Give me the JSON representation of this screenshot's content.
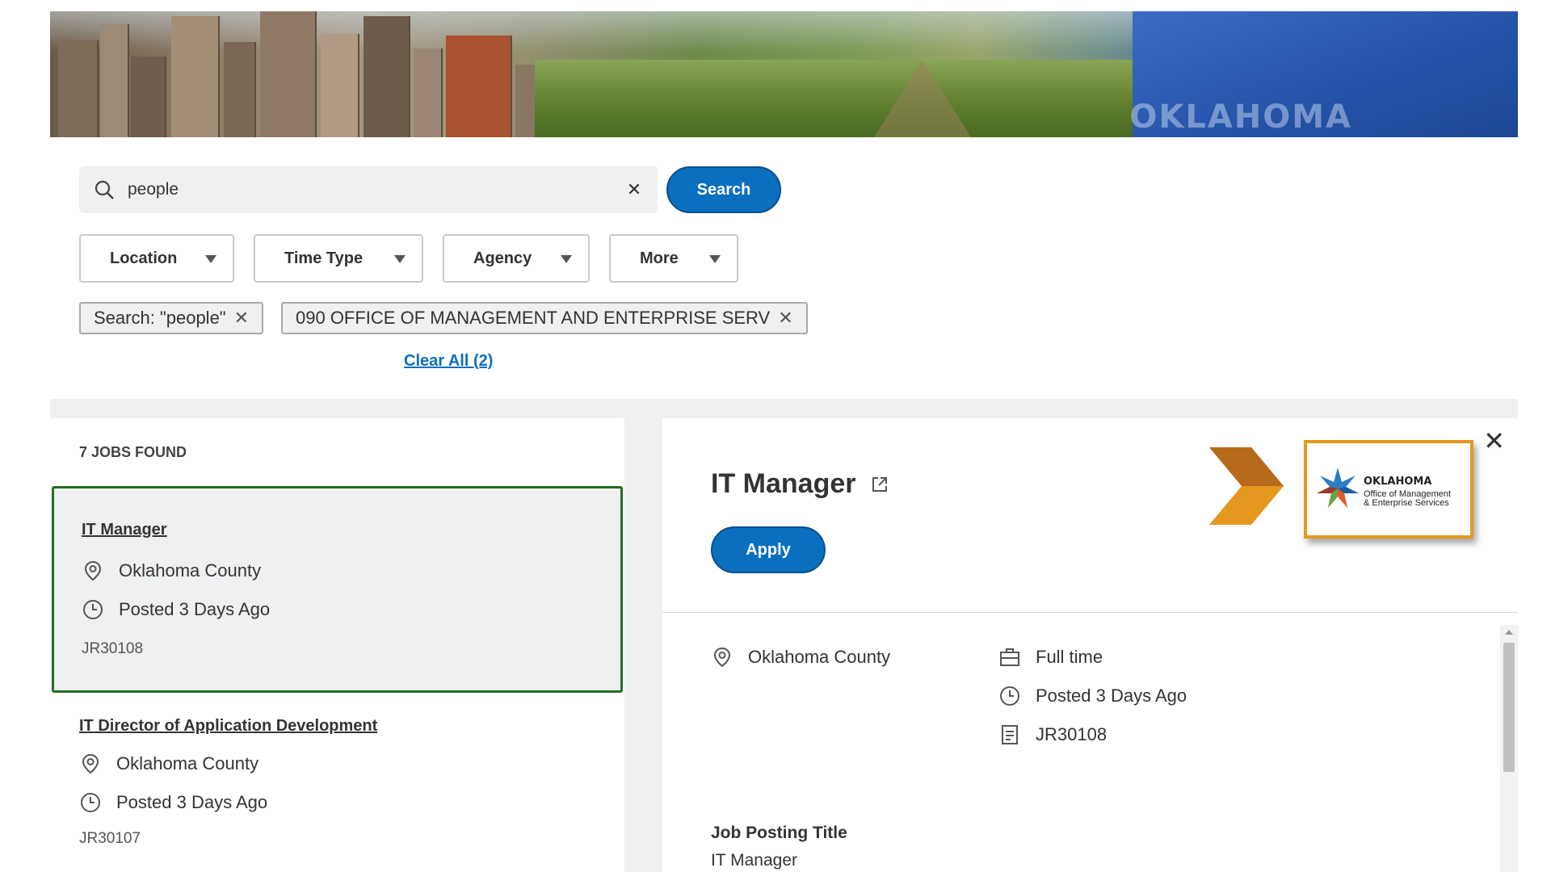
{
  "banner": {
    "flag_word": "OKLAHOMA"
  },
  "search": {
    "value": "people",
    "button_label": "Search"
  },
  "filters": [
    {
      "label": "Location"
    },
    {
      "label": "Time Type"
    },
    {
      "label": "Agency"
    },
    {
      "label": "More"
    }
  ],
  "chips": [
    {
      "label": "Search: \"people\""
    },
    {
      "label": "090 OFFICE OF MANAGEMENT AND ENTERPRISE SERV"
    }
  ],
  "clear_all": "Clear All (2)",
  "results": {
    "count_label": "7 JOBS FOUND",
    "jobs": [
      {
        "title": "IT Manager",
        "location": "Oklahoma County",
        "posted": "Posted 3 Days Ago",
        "req_id": "JR30108"
      },
      {
        "title": "IT Director of Application Development",
        "location": "Oklahoma County",
        "posted": "Posted 3 Days Ago",
        "req_id": "JR30107"
      }
    ]
  },
  "detail": {
    "title": "IT Manager",
    "apply_label": "Apply",
    "location": "Oklahoma County",
    "time_type": "Full time",
    "posted": "Posted 3 Days Ago",
    "req_id": "JR30108",
    "posting_title_label": "Job Posting Title",
    "posting_title_value": "IT Manager"
  },
  "logo": {
    "line1": "OKLAHOMA",
    "line2": "Office of Management",
    "line3": "& Enterprise Services"
  },
  "colors": {
    "primary": "#0b6fbf",
    "selected_border": "#1f6f22",
    "annotation": "#e4981f"
  }
}
